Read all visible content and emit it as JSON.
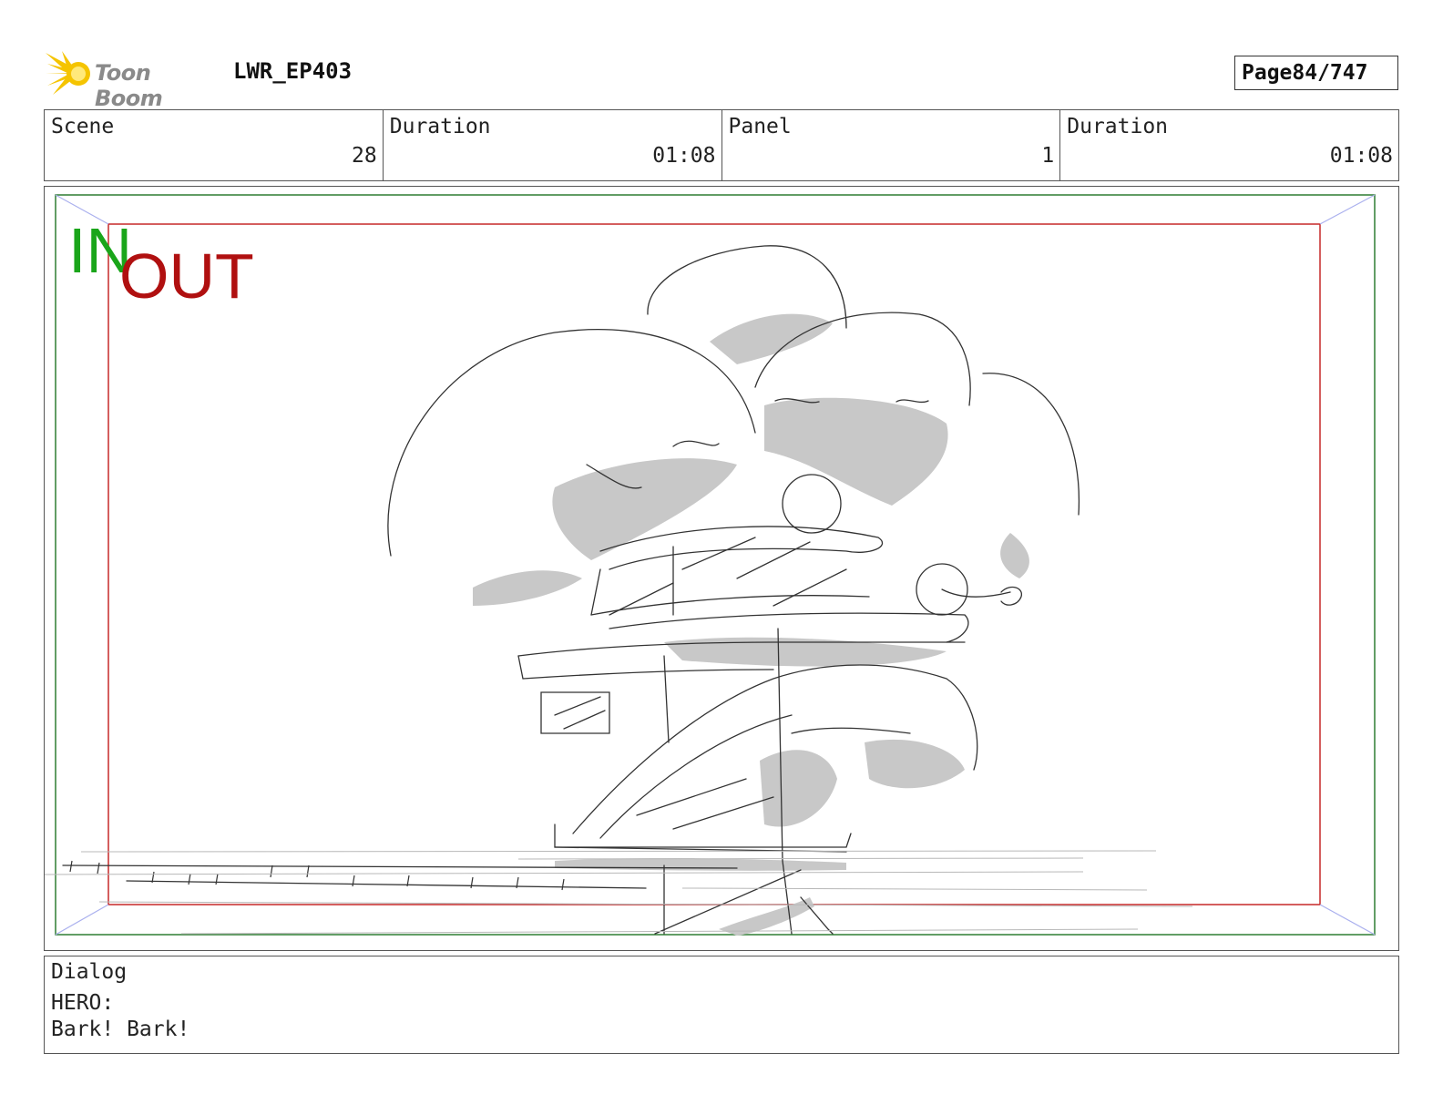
{
  "header": {
    "logo_text": "Toon Boom",
    "project": "LWR_EP403",
    "page_label": "Page",
    "page_value": "84/747"
  },
  "info": {
    "scene_label": "Scene",
    "scene_value": "28",
    "scene_duration_label": "Duration",
    "scene_duration_value": "01:08",
    "panel_label": "Panel",
    "panel_value": "1",
    "panel_duration_label": "Duration",
    "panel_duration_value": "01:08"
  },
  "frame": {
    "in_label": "IN",
    "out_label": "OUT",
    "in_color": "#1aa51a",
    "out_color": "#b01010"
  },
  "dialog": {
    "label": "Dialog",
    "speaker": "HERO:",
    "line": "Bark! Bark!"
  },
  "colors": {
    "logo_star": "#f5c400",
    "logo_text": "#8a8a8a",
    "field_in_border": "#2e7d32",
    "field_out_border": "#c62828",
    "sketch_shadow": "#c8c8c8"
  }
}
